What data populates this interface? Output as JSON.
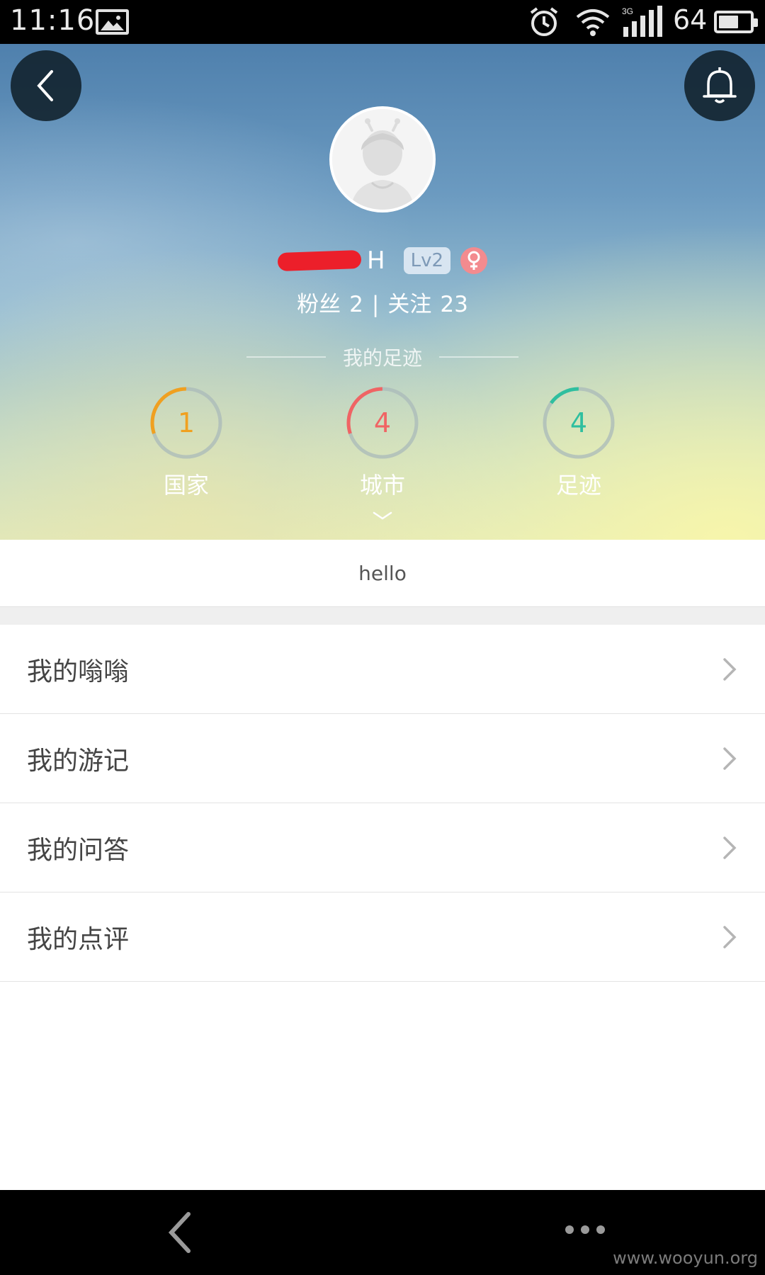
{
  "status_bar": {
    "time": "11:16",
    "network": "3G",
    "battery": "64",
    "battery_fraction": 0.64
  },
  "profile": {
    "name_visible": "H",
    "level": "Lv2",
    "followers_label": "粉丝",
    "followers_count": "2",
    "separator": "|",
    "following_label": "关注",
    "following_count": "23",
    "gender_icon": "female-icon"
  },
  "footprint": {
    "title": "我的足迹",
    "stats": [
      {
        "label": "国家",
        "value": "1",
        "color": "#f0a020",
        "fraction": 0.3
      },
      {
        "label": "城市",
        "value": "4",
        "color": "#f06464",
        "fraction": 0.3
      },
      {
        "label": "足迹",
        "value": "4",
        "color": "#2fbf9f",
        "fraction": 0.15
      }
    ]
  },
  "bio": "hello",
  "menu": {
    "items": [
      {
        "label": "我的嗡嗡"
      },
      {
        "label": "我的游记"
      },
      {
        "label": "我的问答"
      },
      {
        "label": "我的点评"
      }
    ]
  },
  "watermark": "www.wooyun.org",
  "icons": {
    "back": "back-chevron-icon",
    "bell": "bell-icon",
    "expand": "chevron-down-icon",
    "menu_arrow": "chevron-right-icon",
    "more": "more-dots-icon"
  }
}
